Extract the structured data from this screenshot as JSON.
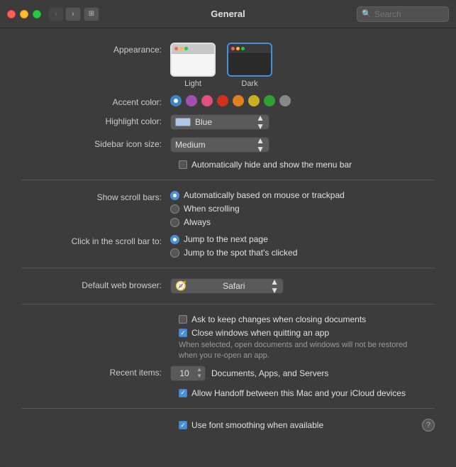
{
  "window": {
    "title": "General"
  },
  "titlebar": {
    "back_label": "‹",
    "forward_label": "›",
    "grid_label": "⊞",
    "search_placeholder": "Search"
  },
  "appearance": {
    "label": "Appearance:",
    "options": [
      {
        "id": "light",
        "label": "Light",
        "selected": false
      },
      {
        "id": "dark",
        "label": "Dark",
        "selected": true
      }
    ]
  },
  "accent_color": {
    "label": "Accent color:",
    "colors": [
      {
        "id": "blue",
        "hex": "#3d85c8",
        "selected": true
      },
      {
        "id": "purple",
        "hex": "#a050b0"
      },
      {
        "id": "pink",
        "hex": "#e05080"
      },
      {
        "id": "red",
        "hex": "#d03020"
      },
      {
        "id": "orange",
        "hex": "#e08020"
      },
      {
        "id": "yellow",
        "hex": "#c8b020"
      },
      {
        "id": "green",
        "hex": "#30a030"
      },
      {
        "id": "graphite",
        "hex": "#888888"
      }
    ]
  },
  "highlight_color": {
    "label": "Highlight color:",
    "value": "Blue",
    "swatch_color": "#b0c8e8"
  },
  "sidebar_icon_size": {
    "label": "Sidebar icon size:",
    "value": "Medium"
  },
  "menu_bar": {
    "label": "",
    "checkbox_label": "Automatically hide and show the menu bar",
    "checked": false
  },
  "show_scroll_bars": {
    "label": "Show scroll bars:",
    "options": [
      {
        "id": "auto",
        "label": "Automatically based on mouse or trackpad",
        "selected": true
      },
      {
        "id": "scrolling",
        "label": "When scrolling",
        "selected": false
      },
      {
        "id": "always",
        "label": "Always",
        "selected": false
      }
    ]
  },
  "click_scroll_bar": {
    "label": "Click in the scroll bar to:",
    "options": [
      {
        "id": "next_page",
        "label": "Jump to the next page",
        "selected": true
      },
      {
        "id": "spot",
        "label": "Jump to the spot that's clicked",
        "selected": false
      }
    ]
  },
  "default_browser": {
    "label": "Default web browser:",
    "value": "Safari"
  },
  "checkboxes": {
    "keep_changes": {
      "label": "Ask to keep changes when closing documents",
      "checked": false
    },
    "close_windows": {
      "label": "Close windows when quitting an app",
      "checked": true,
      "sublabel": "When selected, open documents and windows will not be restored\nwhen you re-open an app."
    }
  },
  "recent_items": {
    "label": "Recent items:",
    "value": "10",
    "suffix": "Documents, Apps, and Servers"
  },
  "handoff": {
    "label": "Allow Handoff between this Mac and your iCloud devices",
    "checked": true
  },
  "font_smoothing": {
    "label": "Use font smoothing when available",
    "checked": true
  },
  "help_label": "?"
}
